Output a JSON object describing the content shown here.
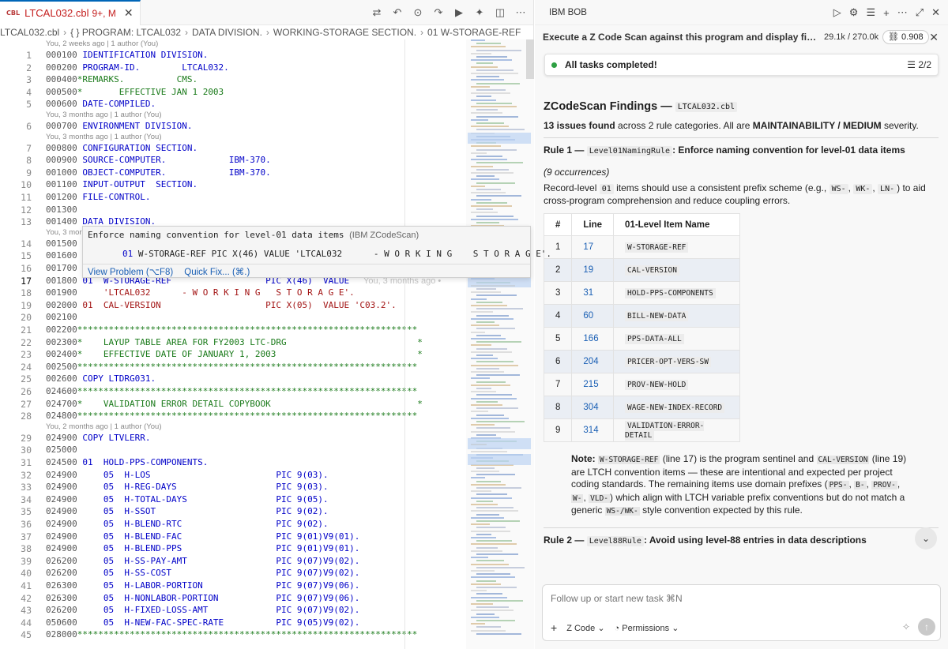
{
  "editor": {
    "tab": {
      "badge": "CBL",
      "filename": "LTCAL032.cbl",
      "status": "9+, M"
    },
    "breadcrumb": [
      "LTCAL032.cbl",
      "{ } PROGRAM: LTCAL032",
      "DATA DIVISION.",
      "WORKING-STORAGE SECTION.",
      "01  W-STORAGE-REF"
    ],
    "blame": [
      {
        "text": "You, 2 weeks ago | 1 author (You)"
      },
      {
        "text": "You, 3 months ago | 1 author (You)"
      },
      {
        "text": "You, 3 months ago | 1 author (You)"
      },
      {
        "text": "You, 3 mor"
      },
      {
        "text": "You, 2 months ago | 1 author (You)"
      }
    ],
    "inline_blame": "You, 3 months ago •",
    "hover": {
      "title": "Enforce naming convention for level-01 data items",
      "source": "(IBM ZCodeScan)",
      "code": "01 W-STORAGE-REF PIC X(46) VALUE 'LTCAL032      - W O R K I N G    S T O R A G E'.",
      "view_problem": "View Problem (⌥F8)",
      "quick_fix": "Quick Fix... (⌘.)"
    },
    "lines": [
      {
        "n": "1",
        "seq": "000100",
        "code": " IDENTIFICATION DIVISION."
      },
      {
        "n": "2",
        "seq": "000200",
        "code": " PROGRAM-ID.        LTCAL032."
      },
      {
        "n": "3",
        "seq": "000400",
        "code": "*REMARKS.          CMS."
      },
      {
        "n": "4",
        "seq": "000500",
        "code": "*       EFFECTIVE JAN 1 2003"
      },
      {
        "n": "5",
        "seq": "000600",
        "code": " DATE-COMPILED."
      },
      {
        "n": "6",
        "seq": "000700",
        "code": " ENVIRONMENT DIVISION."
      },
      {
        "n": "7",
        "seq": "000800",
        "code": " CONFIGURATION SECTION."
      },
      {
        "n": "8",
        "seq": "000900",
        "code": " SOURCE-COMPUTER.            IBM-370."
      },
      {
        "n": "9",
        "seq": "001000",
        "code": " OBJECT-COMPUTER.            IBM-370."
      },
      {
        "n": "10",
        "seq": "001100",
        "code": " INPUT-OUTPUT  SECTION."
      },
      {
        "n": "11",
        "seq": "001200",
        "code": " FILE-CONTROL."
      },
      {
        "n": "12",
        "seq": "001300",
        "code": ""
      },
      {
        "n": "13",
        "seq": "001400",
        "code": " DATA DIVISION."
      },
      {
        "n": "14",
        "seq": "001500",
        "code": ""
      },
      {
        "n": "15",
        "seq": "001600",
        "code": ""
      },
      {
        "n": "16",
        "seq": "001700",
        "code": ""
      },
      {
        "n": "17",
        "seq": "001800",
        "code": " 01  W-STORAGE-REF                  PIC X(46)  VALUE"
      },
      {
        "n": "18",
        "seq": "001900",
        "code": "     'LTCAL032      - W O R K I N G   S T O R A G E'."
      },
      {
        "n": "19",
        "seq": "002000",
        "code": " 01  CAL-VERSION                    PIC X(05)  VALUE 'C03.2'."
      },
      {
        "n": "20",
        "seq": "002100",
        "code": ""
      },
      {
        "n": "21",
        "seq": "002200",
        "code": "*****************************************************************"
      },
      {
        "n": "22",
        "seq": "002300",
        "code": "*    LAYUP TABLE AREA FOR FY2003 LTC-DRG                         *"
      },
      {
        "n": "23",
        "seq": "002400",
        "code": "*    EFFECTIVE DATE OF JANUARY 1, 2003                           *"
      },
      {
        "n": "24",
        "seq": "002500",
        "code": "*****************************************************************"
      },
      {
        "n": "25",
        "seq": "002600",
        "code": " COPY LTDRG031."
      },
      {
        "n": "26",
        "seq": "024600",
        "code": "*****************************************************************"
      },
      {
        "n": "27",
        "seq": "024700",
        "code": "*    VALIDATION ERROR DETAIL COPYBOOK                            *"
      },
      {
        "n": "28",
        "seq": "024800",
        "code": "*****************************************************************"
      },
      {
        "n": "29",
        "seq": "024900",
        "code": " COPY LTVLERR."
      },
      {
        "n": "30",
        "seq": "025000",
        "code": ""
      },
      {
        "n": "31",
        "seq": "024500",
        "code": " 01  HOLD-PPS-COMPONENTS."
      },
      {
        "n": "32",
        "seq": "024900",
        "code": "     05  H-LOS                        PIC 9(03)."
      },
      {
        "n": "33",
        "seq": "024900",
        "code": "     05  H-REG-DAYS                   PIC 9(03)."
      },
      {
        "n": "34",
        "seq": "024900",
        "code": "     05  H-TOTAL-DAYS                 PIC 9(05)."
      },
      {
        "n": "35",
        "seq": "024900",
        "code": "     05  H-SSOT                       PIC 9(02)."
      },
      {
        "n": "36",
        "seq": "024900",
        "code": "     05  H-BLEND-RTC                  PIC 9(02)."
      },
      {
        "n": "37",
        "seq": "024900",
        "code": "     05  H-BLEND-FAC                  PIC 9(01)V9(01)."
      },
      {
        "n": "38",
        "seq": "024900",
        "code": "     05  H-BLEND-PPS                  PIC 9(01)V9(01)."
      },
      {
        "n": "39",
        "seq": "026200",
        "code": "     05  H-SS-PAY-AMT                 PIC 9(07)V9(02)."
      },
      {
        "n": "40",
        "seq": "026200",
        "code": "     05  H-SS-COST                    PIC 9(07)V9(02)."
      },
      {
        "n": "41",
        "seq": "026300",
        "code": "     05  H-LABOR-PORTION              PIC 9(07)V9(06)."
      },
      {
        "n": "42",
        "seq": "026300",
        "code": "     05  H-NONLABOR-PORTION           PIC 9(07)V9(06)."
      },
      {
        "n": "43",
        "seq": "026200",
        "code": "     05  H-FIXED-LOSS-AMT             PIC 9(07)V9(02)."
      },
      {
        "n": "44",
        "seq": "050600",
        "code": "     05  H-NEW-FAC-SPEC-RATE          PIC 9(05)V9(02)."
      },
      {
        "n": "45",
        "seq": "028000",
        "code": "*****************************************************************"
      }
    ]
  },
  "panel": {
    "header": "IBM BOB",
    "task_title": "Execute a Z Code Scan against this program and display fin...",
    "tokens": "29.1k / 270.0k",
    "cost": "0.908",
    "status": "All tasks completed!",
    "status_count": "2/2",
    "findings_title": "ZCodeScan Findings —",
    "findings_file": "LTCAL032.cbl",
    "summary_pre": "13 issues found",
    "summary_mid": " across 2 rule categories. All are ",
    "summary_bold": "MAINTAINABILITY / MEDIUM",
    "summary_post": " severity.",
    "rule1_prefix": "Rule 1 —",
    "rule1_chip": "Level01NamingRule",
    "rule1_desc": ": Enforce naming convention for level-01 data items",
    "rule1_occ": "(9 occurrences)",
    "rule1_text_a": "Record-level",
    "rule1_chip2": "01",
    "rule1_text_b": "items should use a consistent prefix scheme (e.g.,",
    "rule1_ex1": "WS-",
    "rule1_ex2": "WK-",
    "rule1_ex3": "LN-",
    "rule1_text_c": ") to aid cross-program comprehension and reduce coupling errors.",
    "table_headers": [
      "#",
      "Line",
      "01-Level Item Name"
    ],
    "table_rows": [
      {
        "num": "1",
        "line": "17",
        "name": "W-STORAGE-REF"
      },
      {
        "num": "2",
        "line": "19",
        "name": "CAL-VERSION"
      },
      {
        "num": "3",
        "line": "31",
        "name": "HOLD-PPS-COMPONENTS"
      },
      {
        "num": "4",
        "line": "60",
        "name": "BILL-NEW-DATA"
      },
      {
        "num": "5",
        "line": "166",
        "name": "PPS-DATA-ALL"
      },
      {
        "num": "6",
        "line": "204",
        "name": "PRICER-OPT-VERS-SW"
      },
      {
        "num": "7",
        "line": "215",
        "name": "PROV-NEW-HOLD"
      },
      {
        "num": "8",
        "line": "304",
        "name": "WAGE-NEW-INDEX-RECORD"
      },
      {
        "num": "9",
        "line": "314",
        "name": "VALIDATION-ERROR-DETAIL"
      }
    ],
    "note_label": "Note:",
    "note_c1": "W-STORAGE-REF",
    "note_t1": "(line 17) is the program sentinel and",
    "note_c2": "CAL-VERSION",
    "note_t2": "(line 19) are LTCH convention items — these are intentional and expected per project coding standards. The remaining items use domain prefixes (",
    "note_c3": "PPS-",
    "note_c4": "B-",
    "note_c5": "PROV-",
    "note_c6": "W-",
    "note_c7": "VLD-",
    "note_t3": ") which align with LTCH variable prefix conventions but do not match a generic",
    "note_c8": "WS-/WK-",
    "note_t4": "style convention expected by this rule.",
    "rule2_prefix": "Rule 2 —",
    "rule2_chip": "Level88Rule",
    "rule2_desc": ": Avoid using level-88 entries in data descriptions",
    "input_placeholder": "Follow up or start new task ⌘N",
    "mode": "Z Code",
    "permissions": "Permissions"
  }
}
